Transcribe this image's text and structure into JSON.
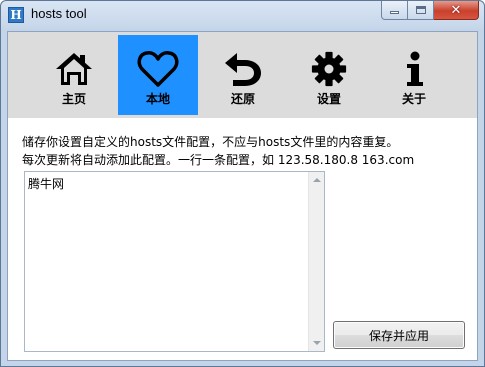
{
  "window": {
    "title": "hosts tool",
    "app_icon_letter": "H"
  },
  "toolbar": {
    "items": [
      {
        "label": "主页",
        "icon": "home-icon",
        "active": false
      },
      {
        "label": "本地",
        "icon": "heart-icon",
        "active": true
      },
      {
        "label": "还原",
        "icon": "undo-icon",
        "active": false
      },
      {
        "label": "设置",
        "icon": "gear-icon",
        "active": false
      },
      {
        "label": "关于",
        "icon": "info-icon",
        "active": false
      }
    ],
    "active_color": "#1e90ff",
    "background_color": "#dcdcdc"
  },
  "description": {
    "line1": "储存你设置自定义的hosts文件配置，不应与hosts文件里的内容重复。",
    "line2": "每次更新将自动添加此配置。一行一条配置，如 123.58.180.8 163.com"
  },
  "editor": {
    "content": "腾牛网"
  },
  "actions": {
    "save_label": "保存并应用"
  }
}
